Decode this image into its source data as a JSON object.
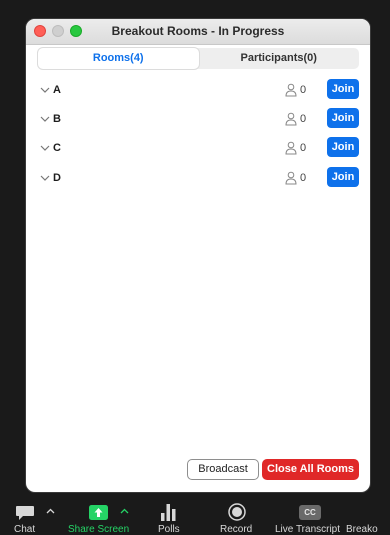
{
  "window": {
    "title": "Breakout Rooms - In Progress"
  },
  "tabs": [
    {
      "label": "Rooms(4)",
      "active": true
    },
    {
      "label": "Participants(0)",
      "active": false
    }
  ],
  "rooms": [
    {
      "name": "A",
      "participants": "0",
      "join_label": "Join"
    },
    {
      "name": "B",
      "participants": "0",
      "join_label": "Join"
    },
    {
      "name": "C",
      "participants": "0",
      "join_label": "Join"
    },
    {
      "name": "D",
      "participants": "0",
      "join_label": "Join"
    }
  ],
  "footer": {
    "broadcast_label": "Broadcast",
    "close_all_label": "Close All Rooms"
  },
  "toolbar": {
    "chat": "Chat",
    "share_screen": "Share Screen",
    "polls": "Polls",
    "record": "Record",
    "live_transcript": "Live Transcript",
    "breakout": "Breako",
    "cc_badge": "CC"
  },
  "colors": {
    "accent_blue": "#0e71eb",
    "danger_red": "#e02828",
    "share_green": "#25d366",
    "toolbar_bg": "#1a1a1a"
  }
}
